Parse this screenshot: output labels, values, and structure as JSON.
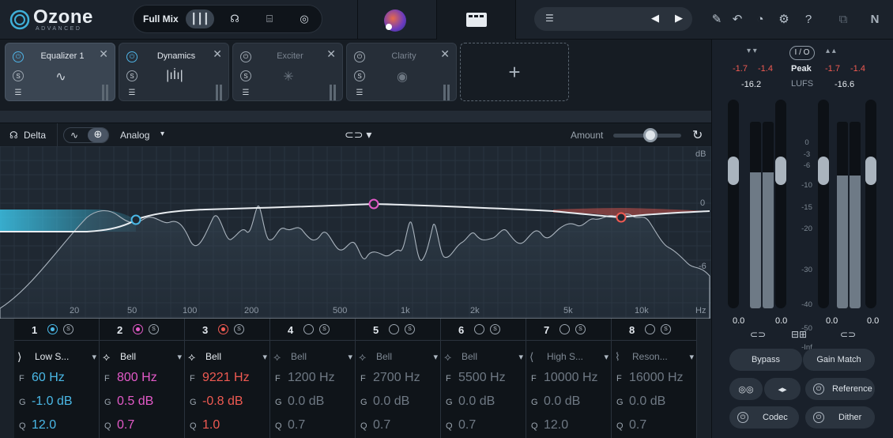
{
  "app": {
    "name": "Ozone",
    "edition": "ADVANCED"
  },
  "assistant": {
    "label": "Full Mix"
  },
  "modules": [
    {
      "name": "Equalizer 1",
      "selected": true,
      "enabled": true
    },
    {
      "name": "Dynamics",
      "selected": false,
      "enabled": true
    },
    {
      "name": "Exciter",
      "selected": false,
      "enabled": false
    },
    {
      "name": "Clarity",
      "selected": false,
      "enabled": false
    }
  ],
  "toolbar": {
    "delta_label": "Delta",
    "mode_label": "Analog",
    "amount_label": "Amount",
    "amount_value": 0.55
  },
  "spectrum": {
    "db_label": "dB",
    "db_ticks": [
      "0",
      "-6"
    ],
    "freq_ticks": [
      "20",
      "50",
      "100",
      "200",
      "500",
      "1k",
      "2k",
      "5k",
      "10k",
      "Hz"
    ]
  },
  "bands": [
    {
      "num": "1",
      "type": "Low S...",
      "f": "60 Hz",
      "g": "-1.0 dB",
      "q": "12.0",
      "color": "#4ab8e6",
      "active": true
    },
    {
      "num": "2",
      "type": "Bell",
      "f": "800 Hz",
      "g": "0.5 dB",
      "q": "0.7",
      "color": "#e35ac8",
      "active": true
    },
    {
      "num": "3",
      "type": "Bell",
      "f": "9221 Hz",
      "g": "-0.8 dB",
      "q": "1.0",
      "color": "#ef5a52",
      "active": true
    },
    {
      "num": "4",
      "type": "Bell",
      "f": "1200 Hz",
      "g": "0.0 dB",
      "q": "0.7",
      "color": "#7f8994",
      "active": false
    },
    {
      "num": "5",
      "type": "Bell",
      "f": "2700 Hz",
      "g": "0.0 dB",
      "q": "0.7",
      "color": "#7f8994",
      "active": false
    },
    {
      "num": "6",
      "type": "Bell",
      "f": "5500 Hz",
      "g": "0.0 dB",
      "q": "0.7",
      "color": "#7f8994",
      "active": false
    },
    {
      "num": "7",
      "type": "High S...",
      "f": "10000 Hz",
      "g": "0.0 dB",
      "q": "12.0",
      "color": "#7f8994",
      "active": false
    },
    {
      "num": "8",
      "type": "Reson...",
      "f": "16000 Hz",
      "g": "0.0 dB",
      "q": "0.7",
      "color": "#7f8994",
      "active": false
    }
  ],
  "param_keys": {
    "f": "F",
    "g": "G",
    "q": "Q"
  },
  "meters": {
    "in_peak_l": "-1.7",
    "in_peak_r": "-1.4",
    "out_peak_l": "-1.7",
    "out_peak_r": "-1.4",
    "in_lufs": "-16.2",
    "out_lufs": "-16.6",
    "io_label": "I / O",
    "peak_label": "Peak",
    "lufs_label": "LUFS",
    "in_gain_l": "0.0",
    "in_gain_r": "0.0",
    "out_gain_l": "0.0",
    "out_gain_r": "0.0",
    "scale": [
      "0",
      "-3",
      "-6",
      "-10",
      "-15",
      "-20",
      "-30",
      "-40",
      "-50",
      "-Inf"
    ]
  },
  "buttons": {
    "bypass": "Bypass",
    "gain_match": "Gain Match",
    "reference": "Reference",
    "codec": "Codec",
    "dither": "Dither"
  }
}
